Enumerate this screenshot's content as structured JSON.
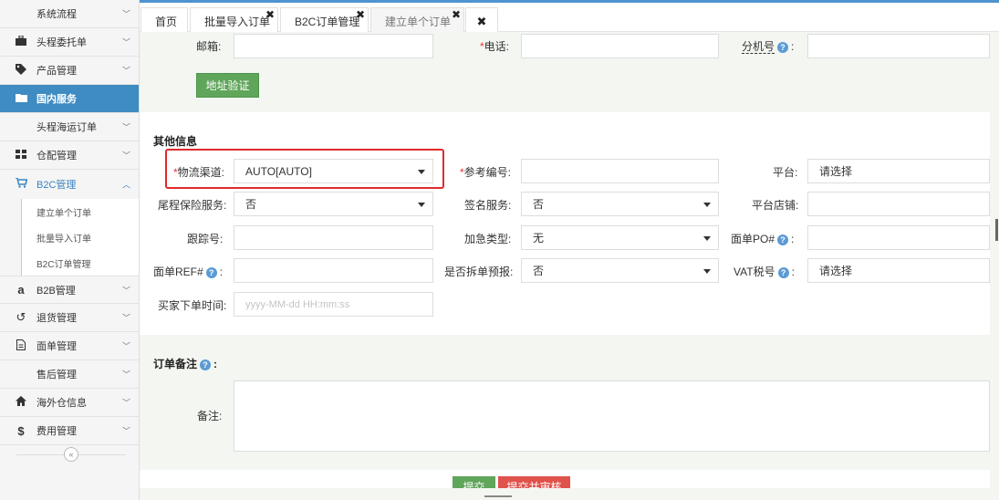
{
  "sidebar": {
    "items": [
      {
        "label": "系统流程",
        "icon": "none"
      },
      {
        "label": "头程委托单",
        "icon": "briefcase-icon"
      },
      {
        "label": "产品管理",
        "icon": "tag-icon"
      },
      {
        "label": "国内服务",
        "icon": "folder-icon"
      },
      {
        "label": "头程海运订单",
        "icon": "none"
      },
      {
        "label": "仓配管理",
        "icon": "grid-icon"
      },
      {
        "label": "B2C管理",
        "icon": "cart-icon"
      },
      {
        "label": "B2B管理",
        "icon": "amazon-icon"
      },
      {
        "label": "退货管理",
        "icon": "undo-icon"
      },
      {
        "label": "面单管理",
        "icon": "file-icon"
      },
      {
        "label": "售后管理",
        "icon": "none"
      },
      {
        "label": "海外仓信息",
        "icon": "home-icon"
      },
      {
        "label": "费用管理",
        "icon": "dollar-icon"
      }
    ],
    "sub_items": [
      "建立单个订单",
      "批量导入订单",
      "B2C订单管理"
    ],
    "collapse_glyph": "«"
  },
  "tabs": {
    "items": [
      {
        "label": "首页"
      },
      {
        "label": "批量导入订单"
      },
      {
        "label": "B2C订单管理"
      },
      {
        "label": "建立单个订单"
      }
    ],
    "close_glyph": "✖",
    "close_all_glyph": "✖"
  },
  "address": {
    "email_label": "邮箱:",
    "phone_label": "电话:",
    "ext_label": "分机号",
    "colon": ":",
    "verify_button": "地址验证"
  },
  "other_info": {
    "title": "其他信息",
    "required_mark": "*",
    "channel_label": "物流渠道:",
    "channel_value": "AUTO[AUTO]",
    "ref_label": "参考编号:",
    "platform_label": "平台:",
    "platform_value": "请选择",
    "insurance_label": "尾程保险服务:",
    "insurance_value": "否",
    "signature_label": "签名服务:",
    "signature_value": "否",
    "store_label": "平台店铺:",
    "tracking_label": "跟踪号:",
    "urgent_label": "加急类型:",
    "urgent_value": "无",
    "po_label": "面单PO#",
    "ref2_label": "面单REF#",
    "split_label": "是否拆单预报:",
    "split_value": "否",
    "vat_label": "VAT税号",
    "vat_value": "请选择",
    "buyer_time_label": "买家下单时间:",
    "buyer_time_placeholder": "yyyy-MM-dd HH:mm:ss"
  },
  "remarks": {
    "title": "订单备注",
    "label": "备注:"
  },
  "actions": {
    "submit": "提交",
    "submit_audit": "提交并审核"
  },
  "colors": {
    "accent": "#3f8cc2",
    "tab_top": "#4f93cf",
    "verify_green": "#5fa55a",
    "submit_green": "#5fa55a",
    "audit_red": "#e0524c",
    "highlight_red": "#e02b2b"
  }
}
